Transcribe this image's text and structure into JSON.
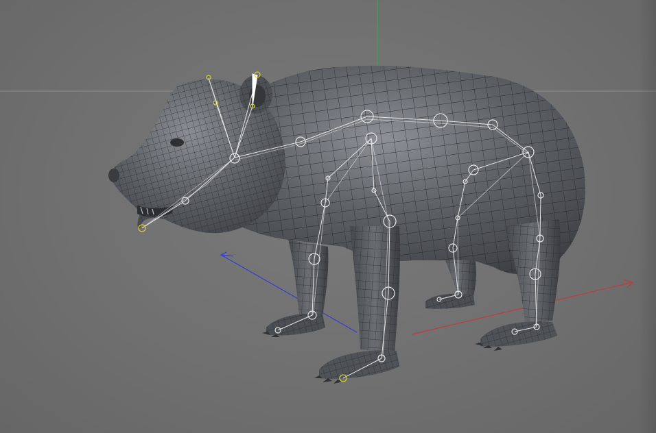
{
  "app": {
    "name": "3D Viewport",
    "view": "perspective"
  },
  "scene": {
    "object": "bear-mesh",
    "rig": "bear-skeleton"
  },
  "colors": {
    "background": "#707070",
    "horizon_line": "#8a8a8a",
    "axis_x": "#c43a3a",
    "axis_y": "#3aa64a",
    "axis_z": "#3a3ad0",
    "mesh_fill": "#5a5d62",
    "mesh_wire": "#26282b",
    "bone": "#e6e6e6",
    "joint_highlight": "#d6d23a"
  }
}
